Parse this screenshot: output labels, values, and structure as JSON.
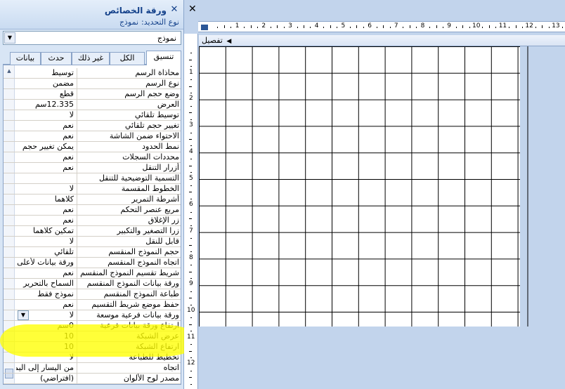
{
  "pane": {
    "title": "ورقة الخصائص",
    "selection_label": "نوع التحديد:",
    "selection_value": "نموذج",
    "object_select_value": "نموذج"
  },
  "tabs": [
    {
      "label": "تنسيق",
      "active": true
    },
    {
      "label": "بيانات",
      "active": false
    },
    {
      "label": "حدث",
      "active": false
    },
    {
      "label": "غير ذلك",
      "active": false
    },
    {
      "label": "الكل",
      "active": false
    }
  ],
  "properties": [
    {
      "name": "محاذاة الرسم",
      "value": "توسيط"
    },
    {
      "name": "نوع الرسم",
      "value": "مضمن"
    },
    {
      "name": "وضع حجم الرسم",
      "value": "قطع"
    },
    {
      "name": "العرض",
      "value": "12.335سم"
    },
    {
      "name": "توسيط تلقائي",
      "value": "لا"
    },
    {
      "name": "تغيير حجم تلقائي",
      "value": "نعم"
    },
    {
      "name": "الاحتواء ضمن الشاشة",
      "value": "نعم"
    },
    {
      "name": "نمط الحدود",
      "value": "يمكن تغيير حجم"
    },
    {
      "name": "محددات السجلات",
      "value": "نعم"
    },
    {
      "name": "أزرار التنقل",
      "value": "نعم"
    },
    {
      "name": "التسمية التوضيحية للتنقل",
      "value": ""
    },
    {
      "name": "الخطوط المقسمة",
      "value": "لا"
    },
    {
      "name": "أشرطة التمرير",
      "value": "كلاهما"
    },
    {
      "name": "مربع عنصر التحكم",
      "value": "نعم"
    },
    {
      "name": "زر الإغلاق",
      "value": "نعم"
    },
    {
      "name": "زرا التصغير والتكبير",
      "value": "تمكين كلاهما"
    },
    {
      "name": "قابل للنقل",
      "value": "لا"
    },
    {
      "name": "حجم النموذج المنقسم",
      "value": "تلقائي"
    },
    {
      "name": "اتجاه النموذج المنقسم",
      "value": "ورقة بيانات لأعلى"
    },
    {
      "name": "شريط تقسيم النموذج المنقسم",
      "value": "نعم"
    },
    {
      "name": "ورقة بيانات النموذج المنقسم",
      "value": "السماح بالتحرير"
    },
    {
      "name": "طباعة النموذج المنقسم",
      "value": "نموذج فقط"
    },
    {
      "name": "حفظ موضع شريط التقسيم",
      "value": "نعم"
    },
    {
      "name": "ورقة بيانات فرعية موسعة",
      "value": "لا",
      "dropdown": true
    },
    {
      "name": "ارتفاع ورقة بيانات فرعية",
      "value": "0سم"
    },
    {
      "name": "عرض الشبكة",
      "value": "10"
    },
    {
      "name": "ارتفاع الشبكة",
      "value": "10"
    },
    {
      "name": "تخطيط للطباعة",
      "value": "لا"
    },
    {
      "name": "اتجاه",
      "value": "من اليسار إلى اليمين"
    },
    {
      "name": "مصدر لوح الألوان",
      "value": "(افتراضي)"
    }
  ],
  "designer": {
    "section_label": "تفصيل",
    "h_ruler_numbers": [
      "1",
      "2",
      "3",
      "4",
      "5",
      "6",
      "7",
      "8",
      "9",
      "10",
      "11",
      "12",
      "13"
    ],
    "v_ruler_numbers": [
      "1",
      "2",
      "3",
      "4",
      "5",
      "6",
      "7",
      "8",
      "9",
      "10",
      "11",
      "12"
    ]
  },
  "colors": {
    "highlight": "#ffff00",
    "design_background": "#c2d4ec",
    "grid_line": "#000000",
    "pane_text": "#15428b"
  }
}
